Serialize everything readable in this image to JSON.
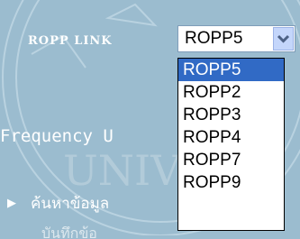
{
  "header": {
    "label": "ROPP LINK"
  },
  "ropp_select": {
    "value": "ROPP5",
    "options": [
      "ROPP5",
      "ROPP2",
      "ROPP3",
      "ROPP4",
      "ROPP7",
      "ROPP9"
    ],
    "selected_index": 0
  },
  "section": {
    "title": "Frequency U"
  },
  "nav": {
    "items": [
      {
        "label": "ค้นหาข้อมูล"
      },
      {
        "label": "บันทึกข้อ"
      }
    ]
  },
  "colors": {
    "background": "#9bbccf",
    "selection": "#316ac5",
    "text_light": "#ffffff"
  }
}
